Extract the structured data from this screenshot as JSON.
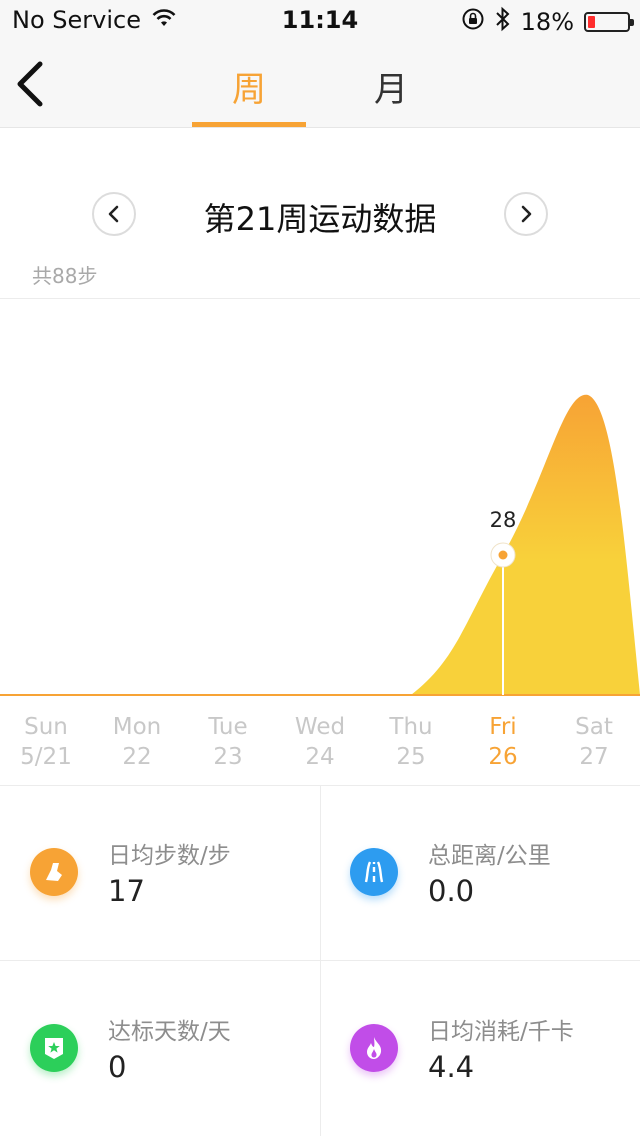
{
  "status_bar": {
    "carrier": "No Service",
    "time": "11:14",
    "battery": "18%",
    "battery_level": 0.18
  },
  "nav": {
    "tabs": [
      {
        "label": "周",
        "active": true
      },
      {
        "label": "月",
        "active": false
      }
    ]
  },
  "week": {
    "title": "第21周运动数据",
    "total": "共88步"
  },
  "chart_data": {
    "type": "area",
    "categories": [
      "Sun 5/21",
      "Mon 22",
      "Tue 23",
      "Wed 24",
      "Thu 25",
      "Fri 26",
      "Sat 27"
    ],
    "values": [
      0,
      0,
      0,
      0,
      0,
      28,
      60
    ],
    "highlight": {
      "index": 5,
      "label": "28"
    },
    "colors": {
      "top": "#f7a335",
      "bottom": "#f8d13a"
    }
  },
  "days": [
    {
      "name": "Sun",
      "date": "5/21",
      "active": false
    },
    {
      "name": "Mon",
      "date": "22",
      "active": false
    },
    {
      "name": "Tue",
      "date": "23",
      "active": false
    },
    {
      "name": "Wed",
      "date": "24",
      "active": false
    },
    {
      "name": "Thu",
      "date": "25",
      "active": false
    },
    {
      "name": "Fri",
      "date": "26",
      "active": true
    },
    {
      "name": "Sat",
      "date": "27",
      "active": false
    }
  ],
  "stats": [
    {
      "label": "日均步数/步",
      "value": "17",
      "icon": "shoe-icon",
      "color": "#f7a335"
    },
    {
      "label": "总距离/公里",
      "value": "0.0",
      "icon": "road-icon",
      "color": "#2d9cf0"
    },
    {
      "label": "达标天数/天",
      "value": "0",
      "icon": "badge-star-icon",
      "color": "#2ccf5a"
    },
    {
      "label": "日均消耗/千卡",
      "value": "4.4",
      "icon": "flame-icon",
      "color": "#c14de8"
    }
  ]
}
